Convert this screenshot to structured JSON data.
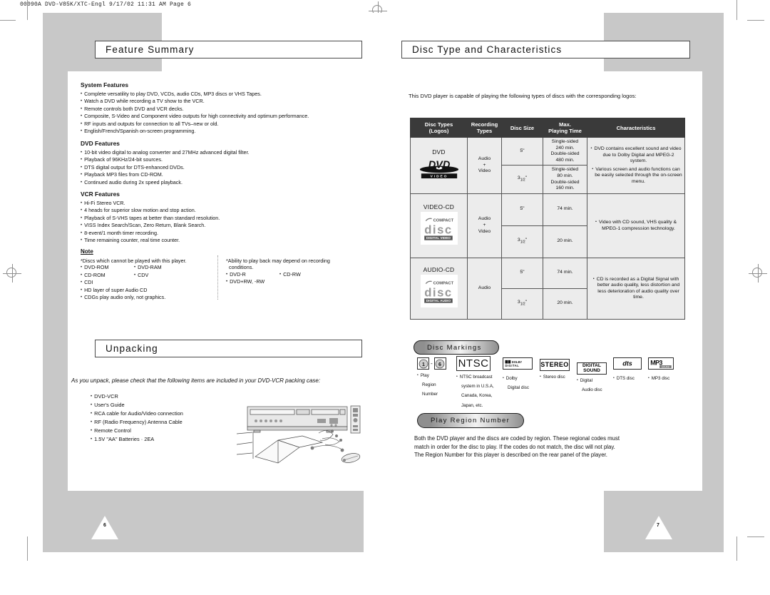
{
  "prepress": {
    "slug": "00090A DVD-V85K/XTC-Engl  9/17/02 11:31 AM  Page 6"
  },
  "left_page": {
    "page_number": "6",
    "sections": [
      {
        "id": "feature-summary",
        "title": "Feature Summary"
      },
      {
        "id": "unpacking",
        "title": "Unpacking"
      }
    ],
    "feature_summary": {
      "groups": [
        {
          "heading": "System Features",
          "items": [
            "Complete versatility to play DVD, VCDs, audio CDs, MP3 discs or VHS Tapes.",
            "Watch a DVD while recording a TV show to the VCR.",
            "Remote controls both DVD and VCR decks.",
            "Composite, S-Video and Component video outputs for high connectivity and optimum performance.",
            "RF inputs and outputs for connection to all TVs–new or old.",
            "English/French/Spanish on-screen programming."
          ]
        },
        {
          "heading": "DVD Features",
          "items": [
            "10-bit video digital to analog converter and 27MHz advanced digital filter.",
            "Playback of 96KHz/24-bit sources.",
            "DTS digital output for DTS-enhanced DVDs.",
            "Playback MP3 files from CD-ROM.",
            "Continued audio during 2x speed playback."
          ]
        },
        {
          "heading": "VCR Features",
          "items": [
            "Hi-Fi Stereo VCR.",
            "4 heads for superior slow motion and stop action.",
            "Playback of S-VHS tapes at better than standard resolution.",
            "VISS Index Search/Scan, Zero Return, Blank Search.",
            "8-event/1 month timer recording.",
            "Time remaining counter, real time counter."
          ]
        }
      ],
      "note": {
        "heading": "Note",
        "left": {
          "lead": "*Discs which cannot be played with this player.",
          "col_a": [
            "DVD-ROM",
            "CD-ROM",
            "CDI",
            "HD layer of super Audio CD",
            "CDGs play audio only, not graphics."
          ],
          "col_b": [
            "DVD-RAM",
            "CDV"
          ]
        },
        "right": {
          "lead": "*Ability to play back may depend on recording",
          "lead2": "conditions.",
          "col_a": [
            "DVD-R",
            "DVD+RW, -RW"
          ],
          "col_b": [
            "CD-RW"
          ]
        }
      }
    },
    "unpacking": {
      "intro": "As you unpack, please check that the following items are included in your DVD-VCR packing case:",
      "items": [
        "DVD-VCR",
        "User's Guide",
        "RCA cable for Audio/Video connection",
        "RF (Radio Frequency) Antenna Cable",
        "Remote Control",
        "1.5V \"AA\" Batteries · 2EA"
      ]
    }
  },
  "right_page": {
    "page_number": "7",
    "title": "Disc Type and Characteristics",
    "intro": "This DVD player is capable of playing the following types of discs with the corresponding logos:",
    "table": {
      "headers": [
        "Disc Types\n(Logos)",
        "Recording\nTypes",
        "Disc Size",
        "Max.\nPlaying Time",
        "Characteristics"
      ],
      "headers_flat": [
        "Disc Types",
        "(Logos)",
        "Recording",
        "Types",
        "Disc Size",
        "Max.",
        "Playing Time",
        "Characteristics"
      ],
      "rows": [
        {
          "disc_type": "DVD",
          "logo": "dvd-video-logo",
          "recording_types": "Audio\n+\nVideo",
          "recording_line1": "Audio",
          "recording_line2": "+",
          "recording_line3": "Video",
          "sizes": [
            {
              "size": "5\"",
              "time": "Single-sided\n240 min.\nDouble-sided\n480 min.",
              "time_lines": [
                "Single-sided",
                "240 min.",
                "Double-sided",
                "480 min."
              ]
            },
            {
              "size": "3¹1⁄²2\"",
              "size_whole": "3",
              "size_frac": "1/2",
              "time_lines": [
                "Single-sided",
                "80 min.",
                "Double-sided",
                "160 min."
              ]
            }
          ],
          "characteristics": [
            "DVD contains excellent sound and video due to Dolby Digital and MPEG-2 system.",
            "Various screen and audio functions can be easily selected through the on-screen menu."
          ]
        },
        {
          "disc_type": "VIDEO-CD",
          "logo": "compact-disc-digital-video-logo",
          "recording_line1": "Audio",
          "recording_line2": "+",
          "recording_line3": "Video",
          "sizes": [
            {
              "size": "5\"",
              "time_lines": [
                "74 min."
              ]
            },
            {
              "size_whole": "3",
              "size_frac": "1/2",
              "time_lines": [
                "20 min."
              ]
            }
          ],
          "characteristics": [
            "Video with CD sound, VHS quality & MPEG-1 compression technology."
          ]
        },
        {
          "disc_type": "AUDIO-CD",
          "logo": "compact-disc-digital-audio-logo",
          "recording_line1": "Audio",
          "recording_line2": "",
          "recording_line3": "",
          "sizes": [
            {
              "size": "5\"",
              "time_lines": [
                "74 min."
              ]
            },
            {
              "size_whole": "3",
              "size_frac": "1/2",
              "time_lines": [
                "20 min."
              ]
            }
          ],
          "characteristics": [
            "CD is recorded as a Digital Signal with better audio quality, less distortion and less deterioration of audio quality over time."
          ]
        }
      ]
    },
    "disc_markings": {
      "title": "Disc Markings",
      "items": [
        {
          "icon": "region-code-icon",
          "glyph": "1 - 6",
          "caption_lines": [
            "Play",
            "Region",
            "Number"
          ]
        },
        {
          "icon": "ntsc-icon",
          "glyph": "NTSC",
          "caption_lines": [
            "NTSC broadcast",
            "system in U.S.A,",
            "Canada, Korea,",
            "Japan, etc."
          ]
        },
        {
          "icon": "dolby-digital-icon",
          "glyph": "DOLBY DIGITAL",
          "caption_lines": [
            "Dolby",
            "Digital disc"
          ]
        },
        {
          "icon": "stereo-icon",
          "glyph": "STEREO",
          "caption_lines": [
            "Stereo disc"
          ]
        },
        {
          "icon": "digital-sound-icon",
          "glyph": "DIGITAL SOUND",
          "caption_lines": [
            "Digital",
            "Audio disc"
          ]
        },
        {
          "icon": "dts-icon",
          "glyph": "dts",
          "caption_lines": [
            "DTS disc"
          ]
        },
        {
          "icon": "mp3-icon",
          "glyph": "MP3",
          "caption_lines": [
            "MP3 disc"
          ]
        }
      ]
    },
    "play_region": {
      "title": "Play Region Number",
      "paragraph_lines": [
        "Both the DVD player and the discs are coded by region. These regional codes must",
        "match in order for the disc to play. If the codes do not match, the disc will not play.",
        "The Region Number for this player is described on the rear panel of the player."
      ]
    }
  },
  "colors": {
    "table_header_bg": "#3a3a3a",
    "table_cell_bg": "#ececec",
    "spread_grey": "#c8c8c8",
    "rule": "#4a4a4a"
  }
}
